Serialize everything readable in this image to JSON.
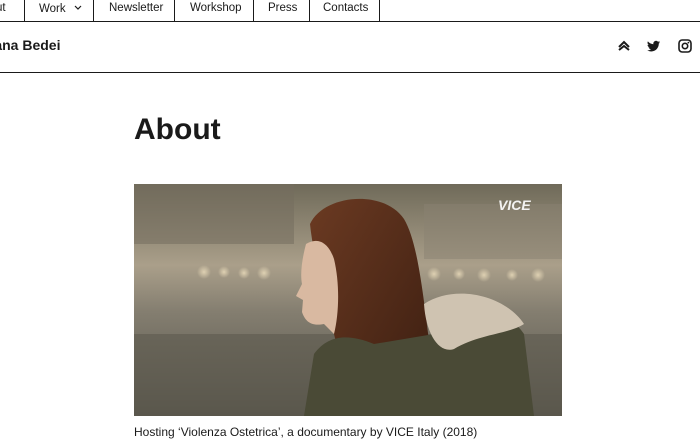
{
  "nav": {
    "items": [
      {
        "label": "ut"
      },
      {
        "label": "Work",
        "dropdown_icon": "chevron-down-icon"
      },
      {
        "label": "Newsletter"
      },
      {
        "label": "Workshop"
      },
      {
        "label": "Press"
      },
      {
        "label": "Contacts"
      }
    ]
  },
  "header": {
    "site_title": "stiana Bedei",
    "social_icons": [
      "vice-icon",
      "twitter-icon",
      "instagram-icon"
    ]
  },
  "page": {
    "title": "About",
    "image": {
      "watermark": "VICE"
    },
    "caption": "Hosting ‘Violenza Ostetrica’, a documentary by VICE Italy (2018)"
  },
  "colors": {
    "text": "#1a1a1a",
    "background": "#ffffff"
  }
}
